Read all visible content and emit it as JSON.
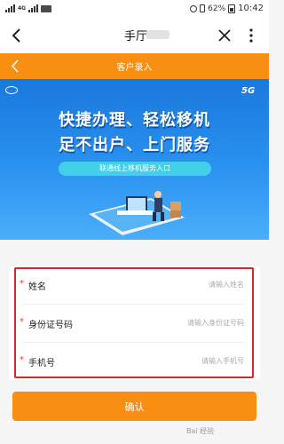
{
  "status_bar": {
    "network": "4G",
    "battery": "62%",
    "time": "10:42"
  },
  "title_bar": {
    "title": "手厅"
  },
  "app_header": {
    "title": "客户录入"
  },
  "banner": {
    "headline_1": "快捷办理、轻松移机",
    "headline_2": "足不出户、上门服务",
    "entry_button": "联通线上移机服务入口",
    "network_tag": "5G"
  },
  "form": {
    "fields": [
      {
        "label": "姓名",
        "placeholder": "请输入姓名",
        "value": ""
      },
      {
        "label": "身份证号码",
        "placeholder": "请输入身份证号码",
        "value": ""
      },
      {
        "label": "手机号",
        "placeholder": "请输入手机号",
        "value": ""
      }
    ],
    "required_mark": "*"
  },
  "confirm_button": "确认",
  "watermark": "Bai 经验",
  "colors": {
    "brand_orange": "#f88f12",
    "highlight_red": "#d42a2a",
    "banner_blue": "#1a78dc"
  }
}
